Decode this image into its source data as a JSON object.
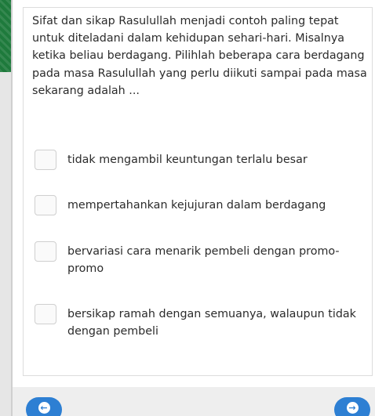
{
  "question": {
    "text": "Sifat dan sikap Rasulullah menjadi contoh paling tepat untuk diteladani dalam kehidupan sehari-hari. Misalnya ketika beliau berdagang. Pilihlah beberapa cara berdagang pada masa Rasulullah yang perlu diikuti sampai pada masa sekarang adalah ..."
  },
  "options": [
    {
      "label": "tidak mengambil keuntungan terlalu besar",
      "checked": false
    },
    {
      "label": "mempertahankan kejujuran dalam berdagang",
      "checked": false
    },
    {
      "label": "bervariasi cara menarik pembeli dengan promo-promo",
      "checked": false
    },
    {
      "label": "bersikap ramah dengan semuanya, walaupun tidak dengan pembeli",
      "checked": false
    }
  ],
  "nav": {
    "prev_icon": "arrow-left-icon",
    "next_icon": "arrow-right-icon",
    "prev_glyph": "←",
    "next_glyph": "→"
  },
  "colors": {
    "accent": "#2d7fd3",
    "sidebar_green": "#1e7a3c"
  }
}
